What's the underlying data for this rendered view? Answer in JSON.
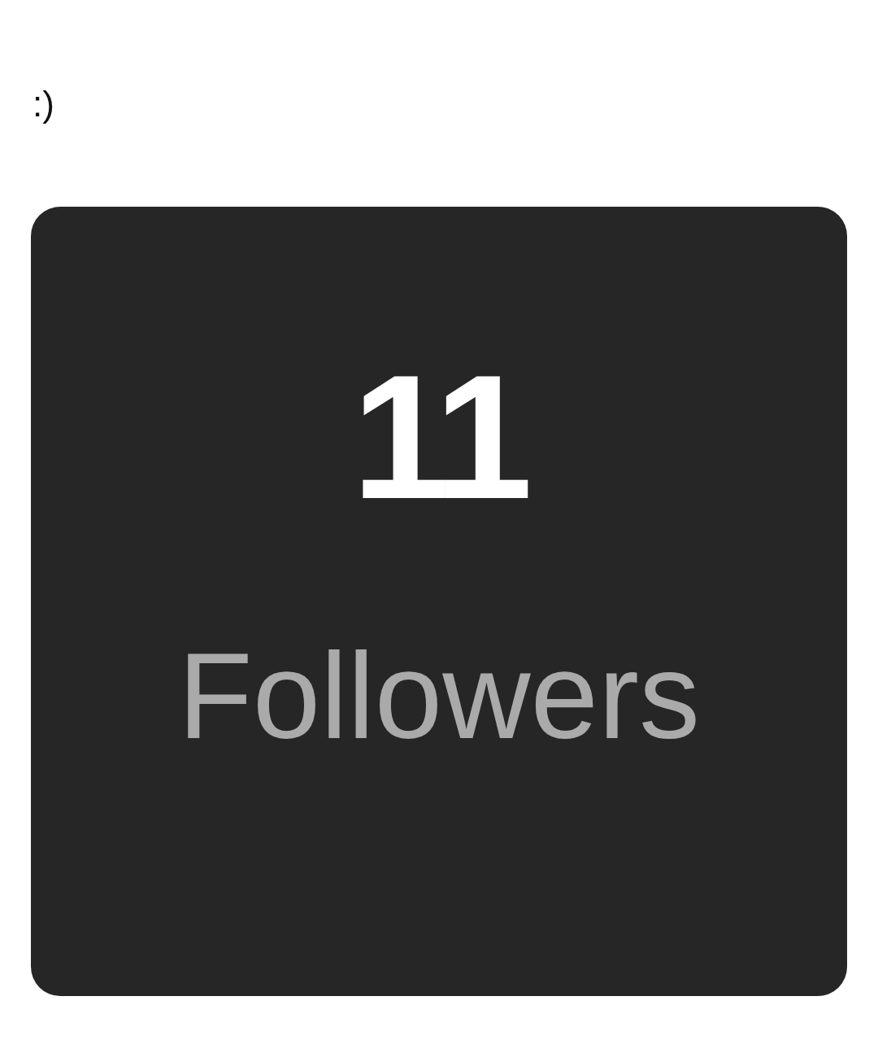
{
  "caption": ":)",
  "card": {
    "count": "11",
    "label": "Followers"
  }
}
